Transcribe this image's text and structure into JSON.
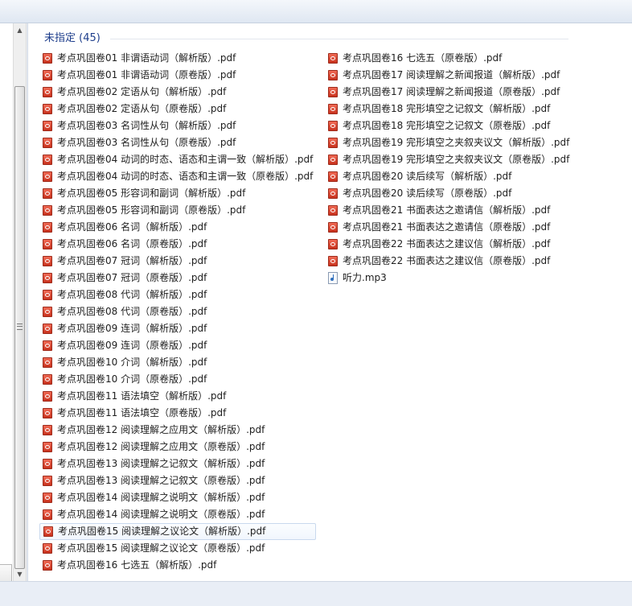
{
  "group": {
    "label": "未指定 (45)"
  },
  "files_col1": [
    {
      "name": "考点巩固卷01 非谓语动词（解析版）.pdf",
      "icon": "pdf-icon"
    },
    {
      "name": "考点巩固卷01 非谓语动词（原卷版）.pdf",
      "icon": "pdf-icon"
    },
    {
      "name": "考点巩固卷02 定语从句（解析版）.pdf",
      "icon": "pdf-icon"
    },
    {
      "name": "考点巩固卷02 定语从句（原卷版）.pdf",
      "icon": "pdf-icon"
    },
    {
      "name": "考点巩固卷03 名词性从句（解析版）.pdf",
      "icon": "pdf-icon"
    },
    {
      "name": "考点巩固卷03 名词性从句（原卷版）.pdf",
      "icon": "pdf-icon"
    },
    {
      "name": "考点巩固卷04 动词的时态、语态和主谓一致（解析版）.pdf",
      "icon": "pdf-icon"
    },
    {
      "name": "考点巩固卷04 动词的时态、语态和主谓一致（原卷版）.pdf",
      "icon": "pdf-icon"
    },
    {
      "name": "考点巩固卷05 形容词和副词（解析版）.pdf",
      "icon": "pdf-icon"
    },
    {
      "name": "考点巩固卷05 形容词和副词（原卷版）.pdf",
      "icon": "pdf-icon"
    },
    {
      "name": "考点巩固卷06 名词（解析版）.pdf",
      "icon": "pdf-icon"
    },
    {
      "name": "考点巩固卷06 名词（原卷版）.pdf",
      "icon": "pdf-icon"
    },
    {
      "name": "考点巩固卷07 冠词（解析版）.pdf",
      "icon": "pdf-icon"
    },
    {
      "name": "考点巩固卷07 冠词（原卷版）.pdf",
      "icon": "pdf-icon"
    },
    {
      "name": "考点巩固卷08 代词（解析版）.pdf",
      "icon": "pdf-icon"
    },
    {
      "name": "考点巩固卷08 代词（原卷版）.pdf",
      "icon": "pdf-icon"
    },
    {
      "name": "考点巩固卷09 连词（解析版）.pdf",
      "icon": "pdf-icon"
    },
    {
      "name": "考点巩固卷09 连词（原卷版）.pdf",
      "icon": "pdf-icon"
    },
    {
      "name": "考点巩固卷10 介词（解析版）.pdf",
      "icon": "pdf-icon"
    },
    {
      "name": "考点巩固卷10 介词（原卷版）.pdf",
      "icon": "pdf-icon"
    },
    {
      "name": "考点巩固卷11 语法填空（解析版）.pdf",
      "icon": "pdf-icon"
    },
    {
      "name": "考点巩固卷11 语法填空（原卷版）.pdf",
      "icon": "pdf-icon"
    },
    {
      "name": "考点巩固卷12 阅读理解之应用文（解析版）.pdf",
      "icon": "pdf-icon"
    },
    {
      "name": "考点巩固卷12 阅读理解之应用文（原卷版）.pdf",
      "icon": "pdf-icon"
    },
    {
      "name": "考点巩固卷13 阅读理解之记叙文（解析版）.pdf",
      "icon": "pdf-icon"
    },
    {
      "name": "考点巩固卷13 阅读理解之记叙文（原卷版）.pdf",
      "icon": "pdf-icon"
    },
    {
      "name": "考点巩固卷14 阅读理解之说明文（解析版）.pdf",
      "icon": "pdf-icon"
    },
    {
      "name": "考点巩固卷14 阅读理解之说明文（原卷版）.pdf",
      "icon": "pdf-icon"
    },
    {
      "name": "考点巩固卷15 阅读理解之议论文（解析版）.pdf",
      "icon": "pdf-icon",
      "selected": true
    },
    {
      "name": "考点巩固卷15 阅读理解之议论文（原卷版）.pdf",
      "icon": "pdf-icon"
    },
    {
      "name": "考点巩固卷16 七选五（解析版）.pdf",
      "icon": "pdf-icon"
    }
  ],
  "files_col2": [
    {
      "name": "考点巩固卷16 七选五（原卷版）.pdf",
      "icon": "pdf-icon"
    },
    {
      "name": "考点巩固卷17 阅读理解之新闻报道（解析版）.pdf",
      "icon": "pdf-icon"
    },
    {
      "name": "考点巩固卷17 阅读理解之新闻报道（原卷版）.pdf",
      "icon": "pdf-icon"
    },
    {
      "name": "考点巩固卷18 完形填空之记叙文（解析版）.pdf",
      "icon": "pdf-icon"
    },
    {
      "name": "考点巩固卷18 完形填空之记叙文（原卷版）.pdf",
      "icon": "pdf-icon"
    },
    {
      "name": "考点巩固卷19 完形填空之夹叙夹议文（解析版）.pdf",
      "icon": "pdf-icon"
    },
    {
      "name": "考点巩固卷19 完形填空之夹叙夹议文（原卷版）.pdf",
      "icon": "pdf-icon"
    },
    {
      "name": "考点巩固卷20 读后续写（解析版）.pdf",
      "icon": "pdf-icon"
    },
    {
      "name": "考点巩固卷20 读后续写（原卷版）.pdf",
      "icon": "pdf-icon"
    },
    {
      "name": "考点巩固卷21 书面表达之邀请信（解析版）.pdf",
      "icon": "pdf-icon"
    },
    {
      "name": "考点巩固卷21 书面表达之邀请信（原卷版）.pdf",
      "icon": "pdf-icon"
    },
    {
      "name": "考点巩固卷22 书面表达之建议信（解析版）.pdf",
      "icon": "pdf-icon"
    },
    {
      "name": "考点巩固卷22 书面表达之建议信（原卷版）.pdf",
      "icon": "pdf-icon"
    },
    {
      "name": "听力.mp3",
      "icon": "mp3-icon"
    }
  ]
}
